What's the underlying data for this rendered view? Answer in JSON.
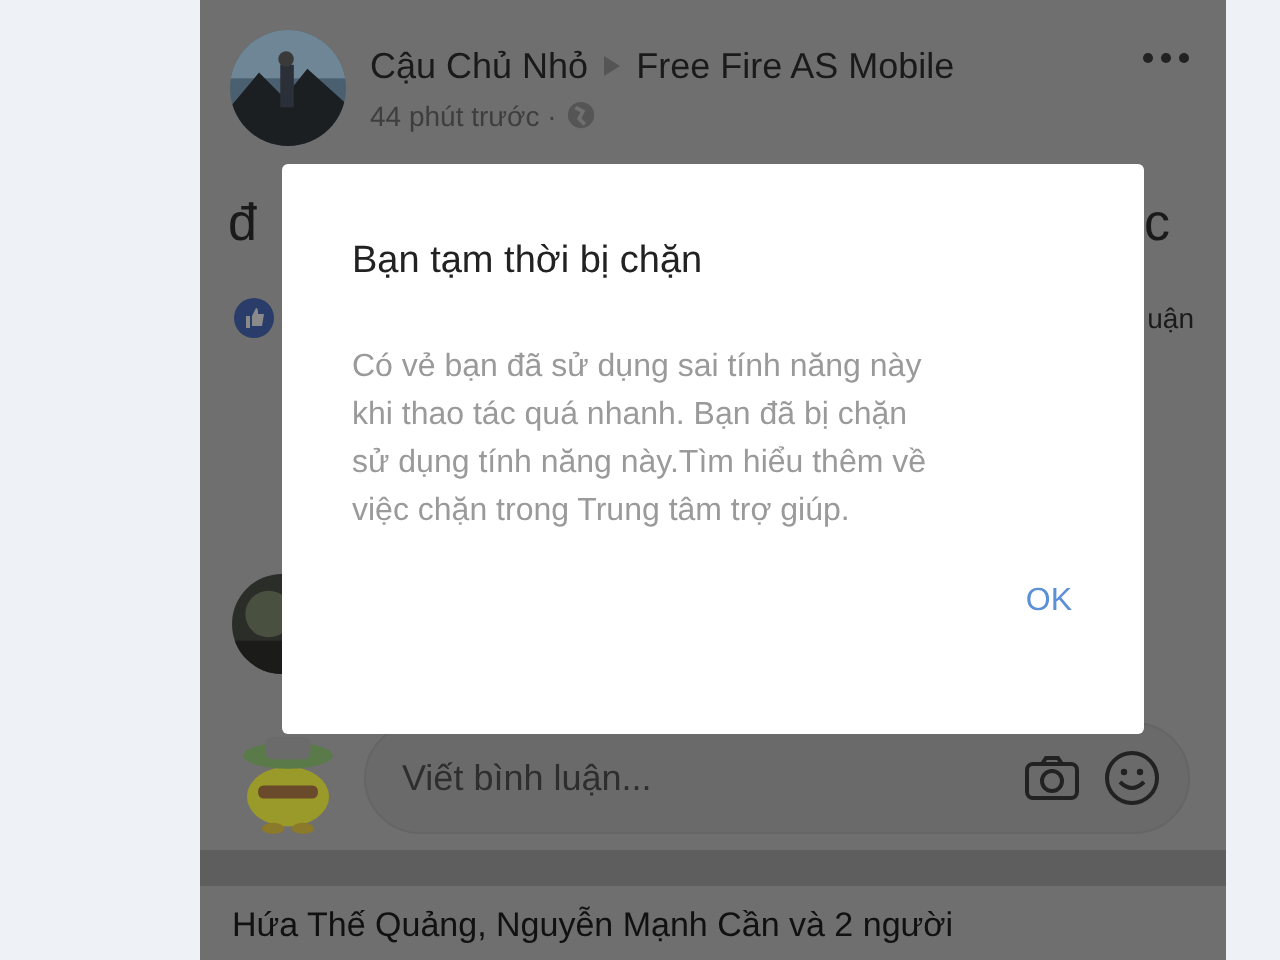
{
  "post": {
    "author": "Cậu Chủ Nhỏ",
    "group": "Free Fire AS Mobile",
    "time": "44 phút trước ·",
    "text_start": "đ",
    "text_end": "c",
    "reaction_text": "uận"
  },
  "comment_box": {
    "placeholder": "Viết bình luận..."
  },
  "next_post": {
    "header": "Hứa Thế Quảng, Nguyễn Mạnh Cần và 2 người"
  },
  "dialog": {
    "title": "Bạn tạm thời bị chặn",
    "message": "Có vẻ bạn đã sử dụng sai tính năng này khi thao tác quá nhanh. Bạn đã bị chặn sử dụng tính năng này.Tìm hiểu thêm về việc chặn trong Trung tâm trợ giúp.",
    "button": "OK"
  }
}
